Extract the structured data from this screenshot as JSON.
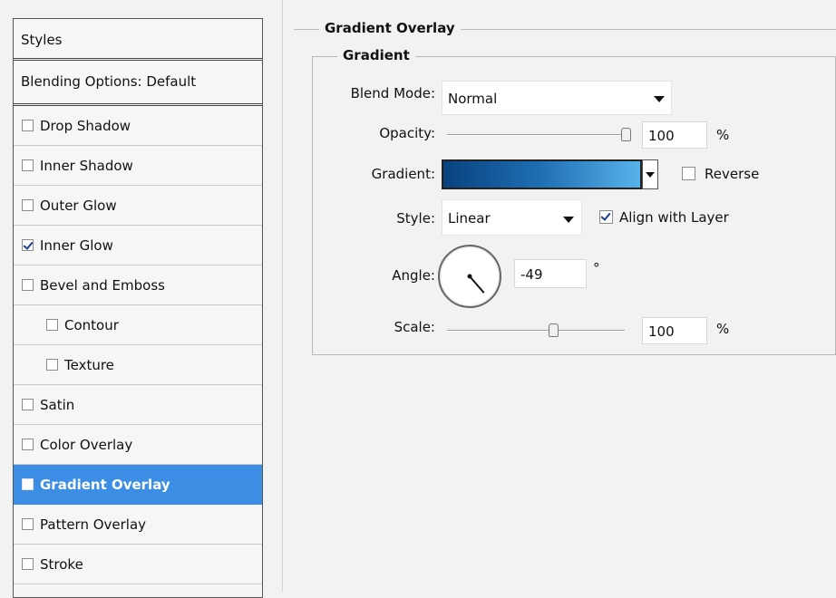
{
  "styles_panel": {
    "header": "Styles",
    "blending": "Blending Options: Default",
    "items": [
      {
        "label": "Drop Shadow",
        "checked": false
      },
      {
        "label": "Inner Shadow",
        "checked": false
      },
      {
        "label": "Outer Glow",
        "checked": false
      },
      {
        "label": "Inner Glow",
        "checked": true
      },
      {
        "label": "Bevel and Emboss",
        "checked": false
      },
      {
        "label": "Contour",
        "checked": false,
        "indent": true
      },
      {
        "label": "Texture",
        "checked": false,
        "indent": true
      },
      {
        "label": "Satin",
        "checked": false
      },
      {
        "label": "Color Overlay",
        "checked": false
      },
      {
        "label": "Gradient Overlay",
        "checked": true,
        "selected": true
      },
      {
        "label": "Pattern Overlay",
        "checked": false
      },
      {
        "label": "Stroke",
        "checked": false
      }
    ],
    "selected_color": "#3b8ee3"
  },
  "gradient_overlay": {
    "title": "Gradient Overlay",
    "section_title": "Gradient",
    "blend_mode_label": "Blend Mode:",
    "blend_mode_value": "Normal",
    "opacity_label": "Opacity:",
    "opacity_value": "100",
    "opacity_unit": "%",
    "opacity_level": 1.0,
    "gradient_label": "Gradient:",
    "gradient_colors": [
      "#08427e",
      "#1f6fb5",
      "#58b3ea"
    ],
    "reverse_label": "Reverse",
    "reverse_checked": false,
    "style_label": "Style:",
    "style_value": "Linear",
    "align_label": "Align with Layer",
    "align_checked": true,
    "angle_label": "Angle:",
    "angle_value": "-49",
    "angle_unit": "°",
    "scale_label": "Scale:",
    "scale_value": "100",
    "scale_unit": "%",
    "scale_level": 0.6
  },
  "icons": {
    "dropdown": "chevron-down-icon",
    "checkbox": "checkbox-icon"
  }
}
